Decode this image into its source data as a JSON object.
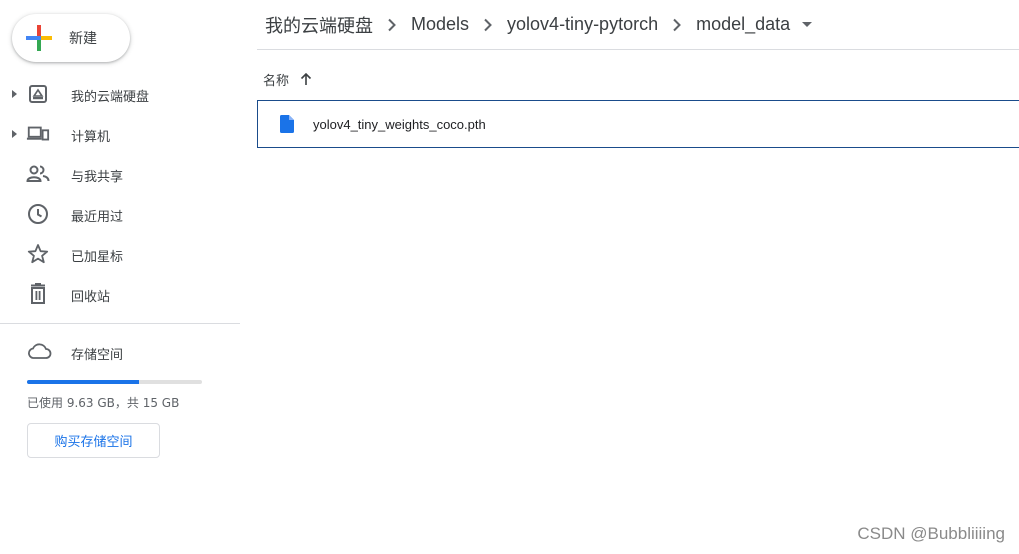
{
  "sidebar": {
    "new_button_label": "新建",
    "items": [
      {
        "label": "我的云端硬盘",
        "icon": "drive-icon",
        "expandable": true
      },
      {
        "label": "计算机",
        "icon": "computers-icon",
        "expandable": true
      },
      {
        "label": "与我共享",
        "icon": "shared-people-icon",
        "expandable": false
      },
      {
        "label": "最近用过",
        "icon": "clock-icon",
        "expandable": false
      },
      {
        "label": "已加星标",
        "icon": "star-icon",
        "expandable": false
      },
      {
        "label": "回收站",
        "icon": "trash-icon",
        "expandable": false
      }
    ],
    "storage": {
      "label": "存储空间",
      "icon": "cloud-icon",
      "used_fraction": 0.64,
      "usage_text": "已使用 9.63 GB，共 15 GB",
      "buy_button_label": "购买存储空间"
    }
  },
  "breadcrumb": {
    "items": [
      "我的云端硬盘",
      "Models",
      "yolov4-tiny-pytorch",
      "model_data"
    ]
  },
  "file_list": {
    "column_name": "名称",
    "files": [
      {
        "name": "yolov4_tiny_weights_coco.pth",
        "icon": "file-icon"
      }
    ]
  },
  "watermark": "CSDN @Bubbliiiing",
  "colors": {
    "accent": "#1a73e8",
    "selection_border": "#1a4c8b",
    "text": "#3c4043",
    "divider": "#dadce0"
  }
}
